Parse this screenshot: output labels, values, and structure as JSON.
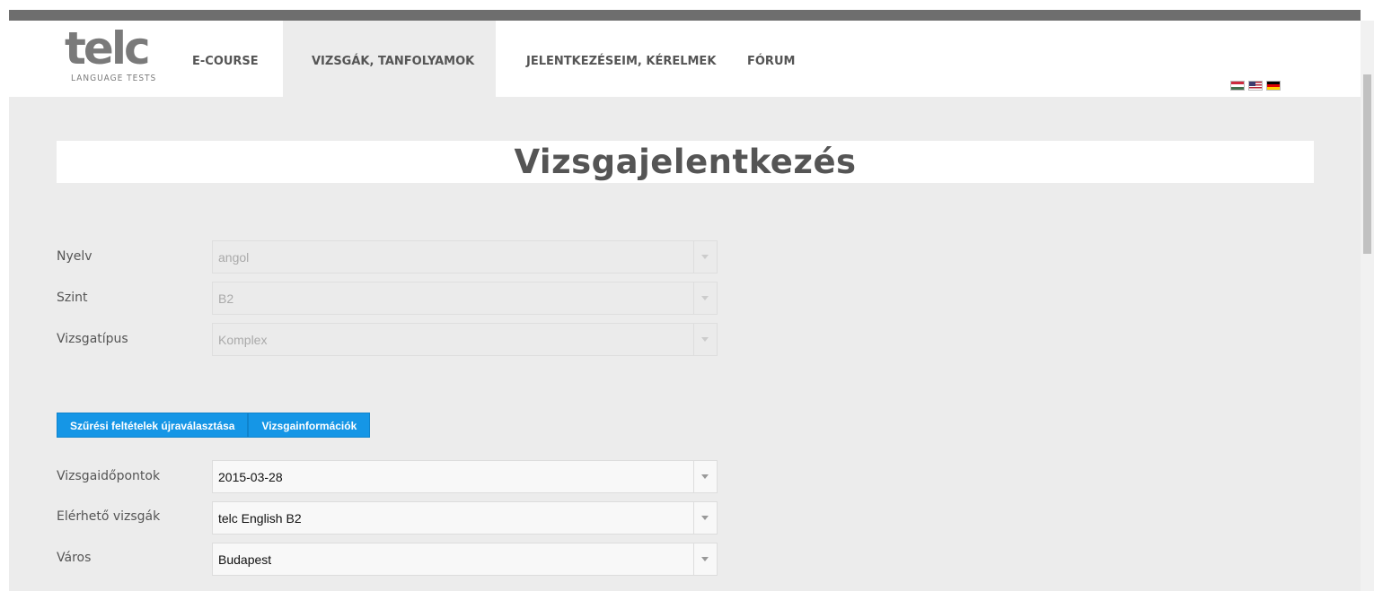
{
  "brand": {
    "logo_text": "telc",
    "logo_tagline": "LANGUAGE TESTS"
  },
  "nav": {
    "items": [
      {
        "label": "E-COURSE"
      },
      {
        "label": "VIZSGÁK, TANFOLYAMOK"
      },
      {
        "label": "JELENTKEZÉSEIM, KÉRELMEK"
      },
      {
        "label": "FÓRUM"
      }
    ],
    "active": "VIZSGÁK, TANFOLYAMOK"
  },
  "languages": [
    "hu-flag-icon",
    "en-flag-icon",
    "de-flag-icon"
  ],
  "page": {
    "title": "Vizsgajelentkezés"
  },
  "filters": [
    {
      "label": "Nyelv",
      "value": "angol"
    },
    {
      "label": "Szint",
      "value": "B2"
    },
    {
      "label": "Vizsgatípus",
      "value": "Komplex"
    }
  ],
  "buttons": {
    "reset_filters": "Szűrési feltételek újraválasztása",
    "exam_info": "Vizsgainformációk"
  },
  "selections": [
    {
      "label": "Vizsgaidőpontok",
      "value": "2015-03-28"
    },
    {
      "label": "Elérhető vizsgák",
      "value": "telc English B2"
    },
    {
      "label": "Város",
      "value": "Budapest"
    }
  ],
  "colors": {
    "button": "#1596e6",
    "background": "#ececec",
    "text": "#555555",
    "topbar": "#6e6e6e"
  }
}
